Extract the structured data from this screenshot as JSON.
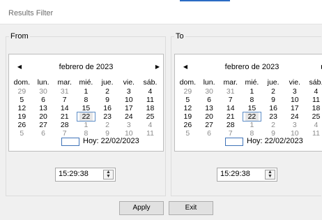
{
  "window": {
    "title": "Results Filter",
    "accent_color": "#2b6cc4"
  },
  "from": {
    "label": "From",
    "calendar": {
      "prev_icon": "left-arrow-icon",
      "next_icon": "right-arrow-icon",
      "month": "febrero de 2023",
      "weekdays": [
        "dom.",
        "lun.",
        "mar.",
        "mié.",
        "jue.",
        "vie.",
        "sáb."
      ],
      "weeks": [
        [
          "29",
          "30",
          "31",
          "1",
          "2",
          "3",
          "4"
        ],
        [
          "5",
          "6",
          "7",
          "8",
          "9",
          "10",
          "11"
        ],
        [
          "12",
          "13",
          "14",
          "15",
          "16",
          "17",
          "18"
        ],
        [
          "19",
          "20",
          "21",
          "22",
          "23",
          "24",
          "25"
        ],
        [
          "26",
          "27",
          "28",
          "1",
          "2",
          "3",
          "4"
        ],
        [
          "5",
          "6",
          "7",
          "8",
          "9",
          "10",
          "11"
        ]
      ],
      "selected_day": "22",
      "today_label": "Hoy: 22/02/2023"
    },
    "time": {
      "value": "15:29:38"
    }
  },
  "to": {
    "label": "To",
    "calendar": {
      "prev_icon": "left-arrow-icon",
      "next_icon": "right-arrow-icon",
      "month": "febrero de 2023",
      "weekdays": [
        "dom.",
        "lun.",
        "mar.",
        "mié.",
        "jue.",
        "vie.",
        "sáb."
      ],
      "weeks": [
        [
          "29",
          "30",
          "31",
          "1",
          "2",
          "3",
          "4"
        ],
        [
          "5",
          "6",
          "7",
          "8",
          "9",
          "10",
          "11"
        ],
        [
          "12",
          "13",
          "14",
          "15",
          "16",
          "17",
          "18"
        ],
        [
          "19",
          "20",
          "21",
          "22",
          "23",
          "24",
          "25"
        ],
        [
          "26",
          "27",
          "28",
          "1",
          "2",
          "3",
          "4"
        ],
        [
          "5",
          "6",
          "7",
          "8",
          "9",
          "10",
          "11"
        ]
      ],
      "selected_day": "22",
      "today_label": "Hoy: 22/02/2023"
    },
    "time": {
      "value": "15:29:38"
    }
  },
  "buttons": {
    "apply": "Apply",
    "exit": "Exit"
  }
}
